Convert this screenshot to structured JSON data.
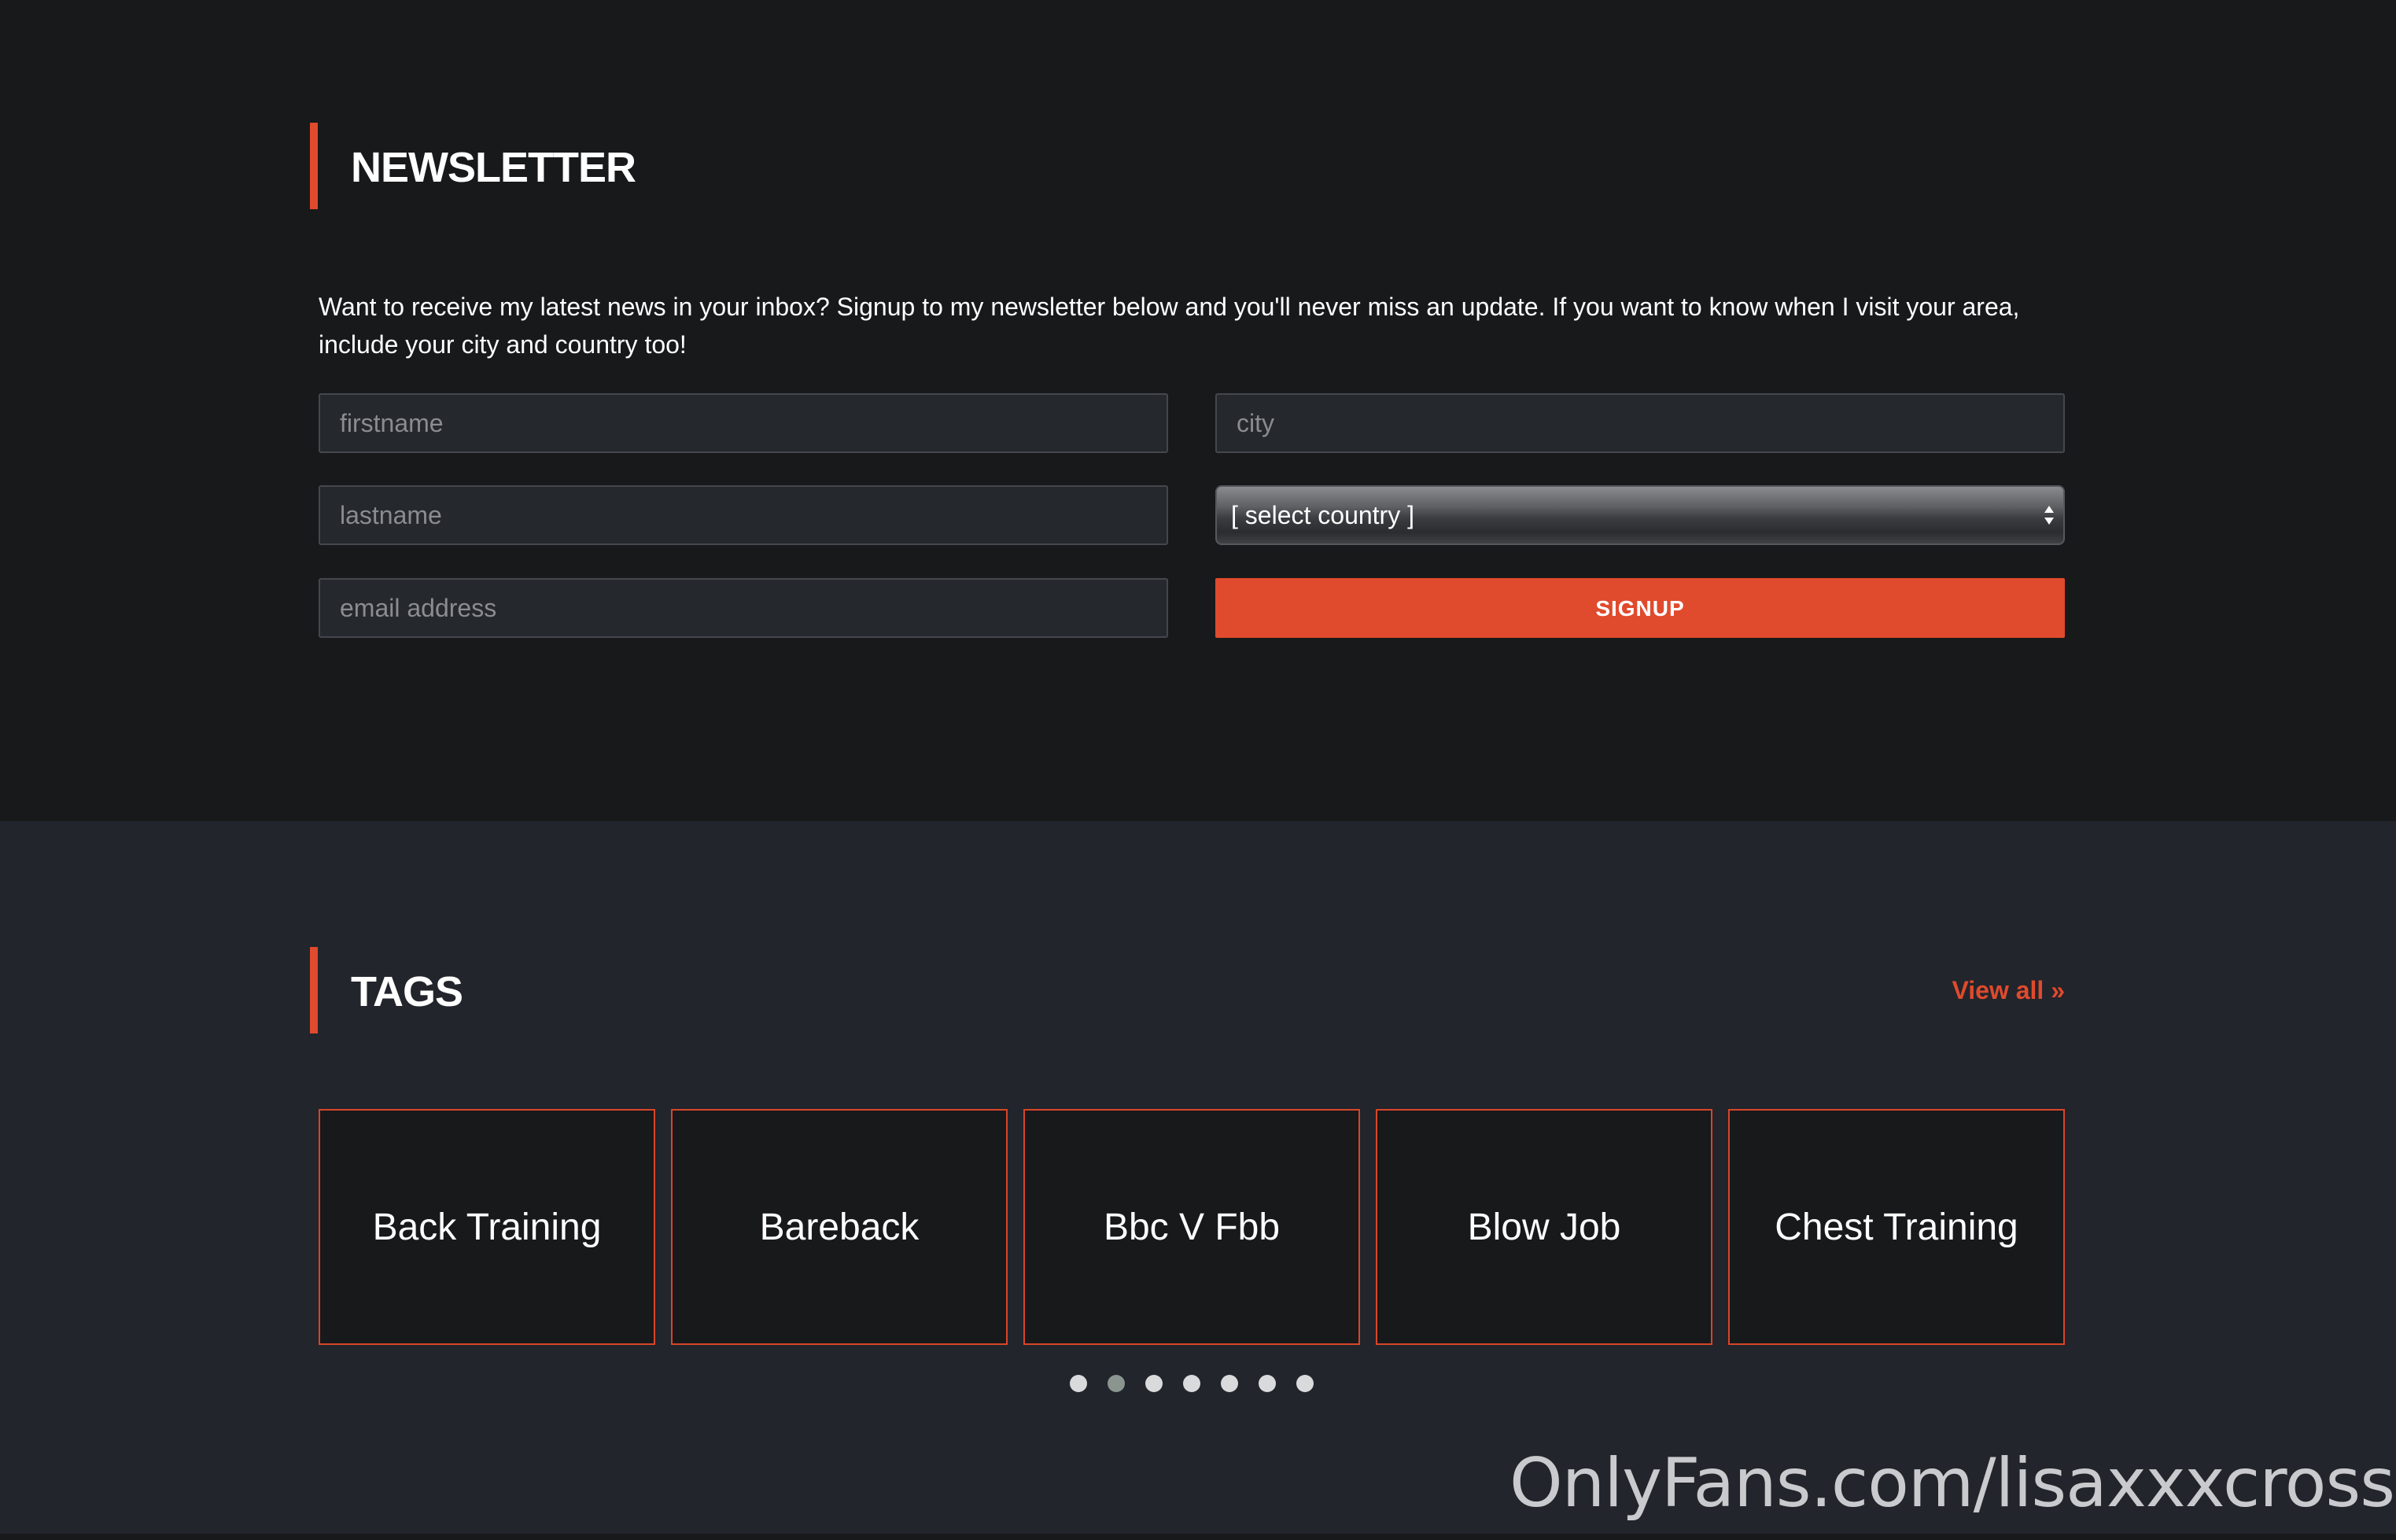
{
  "newsletter": {
    "title": "NEWSLETTER",
    "intro": "Want to receive my latest news in your inbox? Signup to my newsletter below and you'll never miss an update. If you want to know when I visit your area, include your city and country too!",
    "firstname_placeholder": "firstname",
    "lastname_placeholder": "lastname",
    "email_placeholder": "email address",
    "city_placeholder": "city",
    "country_selected": "[ select country ]",
    "signup_label": "SIGNUP"
  },
  "tags": {
    "title": "TAGS",
    "view_all": "View all »",
    "items": [
      {
        "label": "Back Training"
      },
      {
        "label": "Bareback"
      },
      {
        "label": "Bbc V Fbb"
      },
      {
        "label": "Blow Job"
      },
      {
        "label": "Chest Training"
      }
    ],
    "carousel": {
      "page_count": 7,
      "active_index": 1
    }
  },
  "watermark": "OnlyFans.com/lisaxxxcross",
  "colors": {
    "accent": "#e04a2d",
    "newsletter_bg": "#18191b",
    "tags_bg": "#22252b"
  }
}
